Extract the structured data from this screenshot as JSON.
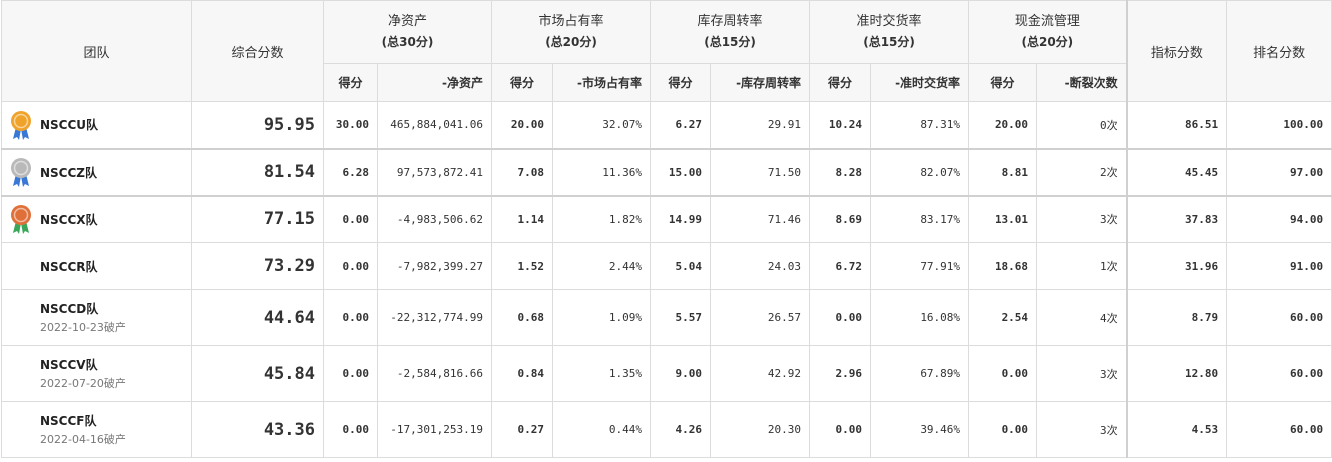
{
  "headers": {
    "team": "团队",
    "total": "综合分数",
    "groups": [
      {
        "title": "净资产",
        "sub": "(总30分)",
        "cols": [
          "得分",
          "-净资产"
        ]
      },
      {
        "title": "市场占有率",
        "sub": "(总20分)",
        "cols": [
          "得分",
          "-市场占有率"
        ]
      },
      {
        "title": "库存周转率",
        "sub": "(总15分)",
        "cols": [
          "得分",
          "-库存周转率"
        ]
      },
      {
        "title": "准时交货率",
        "sub": "(总15分)",
        "cols": [
          "得分",
          "-准时交货率"
        ]
      },
      {
        "title": "现金流管理",
        "sub": "(总20分)",
        "cols": [
          "得分",
          "-断裂次数"
        ]
      }
    ],
    "indicator": "指标分数",
    "rank": "排名分数"
  },
  "medal_colors": {
    "gold": "#f0a32b",
    "silver": "#b9b9b9",
    "bronze": "#e0703a",
    "ribbon_blue": "#3a78d6",
    "ribbon_green": "#3aa65a"
  },
  "rows": [
    {
      "team": "NSCCU队",
      "date": "",
      "medal": "gold-medal-icon",
      "total": "95.95",
      "cells": [
        "30.00",
        "465,884,041.06",
        "20.00",
        "32.07%",
        "6.27",
        "29.91",
        "10.24",
        "87.31%",
        "20.00",
        "0次"
      ],
      "indicator": "86.51",
      "rank": "100.00"
    },
    {
      "team": "NSCCZ队",
      "date": "",
      "medal": "silver-medal-icon",
      "total": "81.54",
      "cells": [
        "6.28",
        "97,573,872.41",
        "7.08",
        "11.36%",
        "15.00",
        "71.50",
        "8.28",
        "82.07%",
        "8.81",
        "2次"
      ],
      "indicator": "45.45",
      "rank": "97.00"
    },
    {
      "team": "NSCCX队",
      "date": "",
      "medal": "bronze-medal-icon",
      "total": "77.15",
      "cells": [
        "0.00",
        "-4,983,506.62",
        "1.14",
        "1.82%",
        "14.99",
        "71.46",
        "8.69",
        "83.17%",
        "13.01",
        "3次"
      ],
      "indicator": "37.83",
      "rank": "94.00"
    },
    {
      "team": "NSCCR队",
      "date": "",
      "medal": "",
      "total": "73.29",
      "cells": [
        "0.00",
        "-7,982,399.27",
        "1.52",
        "2.44%",
        "5.04",
        "24.03",
        "6.72",
        "77.91%",
        "18.68",
        "1次"
      ],
      "indicator": "31.96",
      "rank": "91.00"
    },
    {
      "team": "NSCCD队",
      "date": "2022-10-23破产",
      "medal": "",
      "total": "44.64",
      "cells": [
        "0.00",
        "-22,312,774.99",
        "0.68",
        "1.09%",
        "5.57",
        "26.57",
        "0.00",
        "16.08%",
        "2.54",
        "4次"
      ],
      "indicator": "8.79",
      "rank": "60.00"
    },
    {
      "team": "NSCCV队",
      "date": "2022-07-20破产",
      "medal": "",
      "total": "45.84",
      "cells": [
        "0.00",
        "-2,584,816.66",
        "0.84",
        "1.35%",
        "9.00",
        "42.92",
        "2.96",
        "67.89%",
        "0.00",
        "3次"
      ],
      "indicator": "12.80",
      "rank": "60.00"
    },
    {
      "team": "NSCCF队",
      "date": "2022-04-16破产",
      "medal": "",
      "total": "43.36",
      "cells": [
        "0.00",
        "-17,301,253.19",
        "0.27",
        "0.44%",
        "4.26",
        "20.30",
        "0.00",
        "39.46%",
        "0.00",
        "3次"
      ],
      "indicator": "4.53",
      "rank": "60.00"
    }
  ]
}
